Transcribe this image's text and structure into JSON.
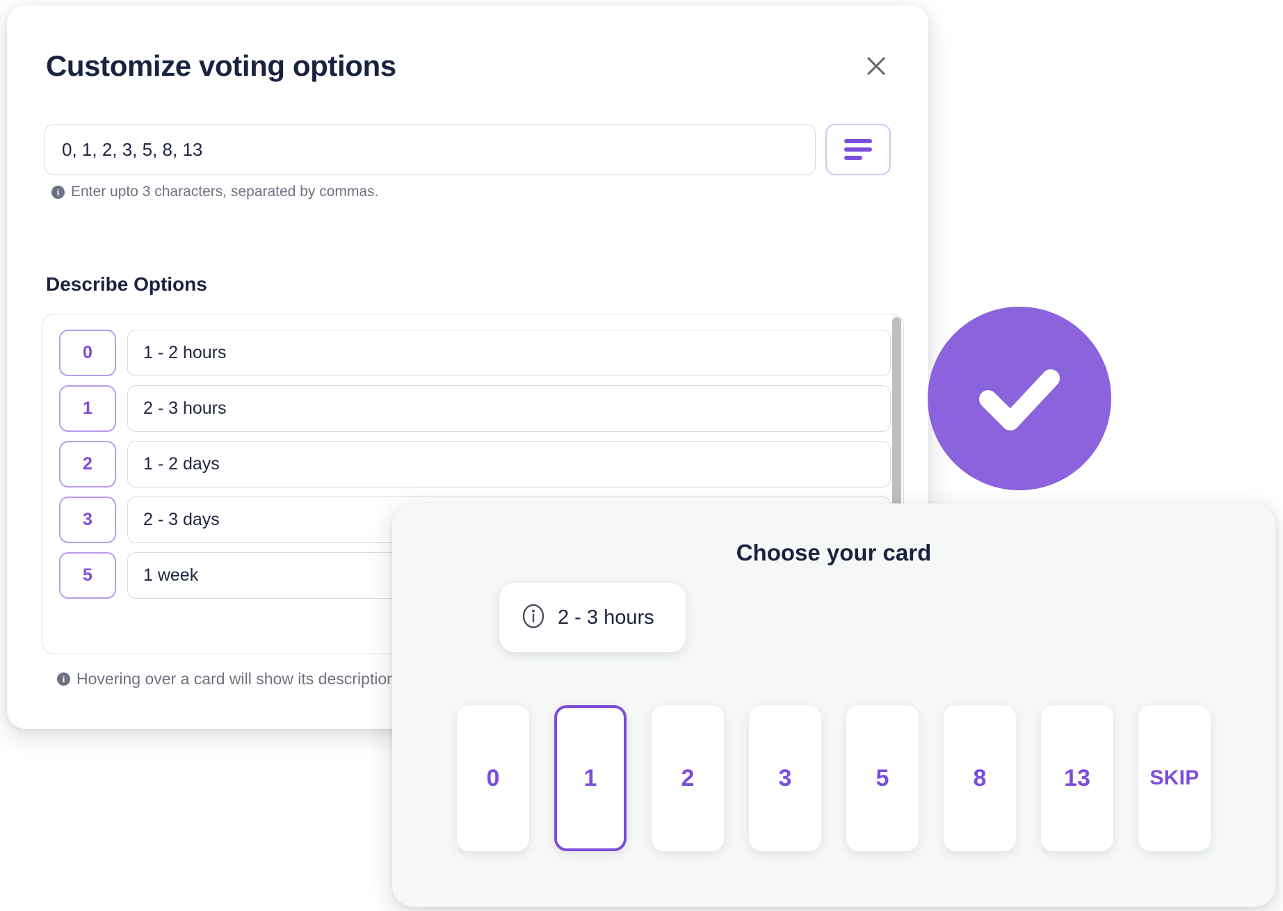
{
  "theme": {
    "accent": "#7c4ddb",
    "accent_badge": "#8a63dd",
    "accent_border_soft": "#b79cec",
    "title_color": "#1b2240",
    "panel_bg": "#f5f8f7",
    "hint_color": "#6d7280"
  },
  "dialog": {
    "title": "Customize voting options",
    "close_icon": "close-icon",
    "values_input": {
      "value": "0, 1, 2, 3, 5, 8, 13",
      "placeholder": "0, 1, 2, 3, 5, 8, 13"
    },
    "align_button_icon": "align-left-icon",
    "hint_values": "Enter upto 3 characters, separated by commas.",
    "section_label": "Describe Options",
    "options": [
      {
        "chip": "0",
        "description": "1 - 2 hours"
      },
      {
        "chip": "1",
        "description": "2 - 3 hours"
      },
      {
        "chip": "2",
        "description": "1 - 2 days"
      },
      {
        "chip": "3",
        "description": "2 - 3 days"
      },
      {
        "chip": "5",
        "description": "1 week"
      }
    ],
    "hint_hover": "Hovering over a card will show its description."
  },
  "check_badge": {
    "icon": "check-icon"
  },
  "card_panel": {
    "title": "Choose your card",
    "tooltip": {
      "icon": "info-circle-icon",
      "text": "2 - 3 hours"
    },
    "cards": [
      {
        "label": "0",
        "selected": false
      },
      {
        "label": "1",
        "selected": true
      },
      {
        "label": "2",
        "selected": false
      },
      {
        "label": "3",
        "selected": false
      },
      {
        "label": "5",
        "selected": false
      },
      {
        "label": "8",
        "selected": false
      },
      {
        "label": "13",
        "selected": false
      },
      {
        "label": "SKIP",
        "selected": false
      }
    ]
  }
}
